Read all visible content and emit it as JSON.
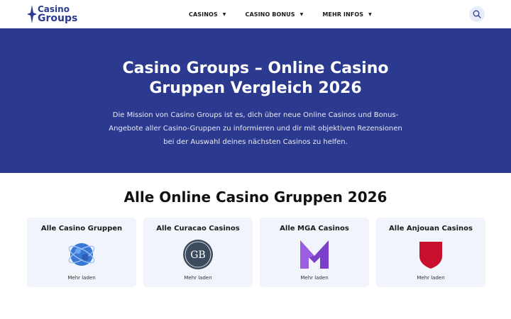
{
  "logo": {
    "line1": "Casino",
    "line2": "Groups"
  },
  "nav": [
    {
      "label": "CASINOS"
    },
    {
      "label": "CASINO BONUS"
    },
    {
      "label": "MEHR INFOS"
    }
  ],
  "hero": {
    "title_line1": "Casino Groups – Online Casino",
    "title_line2": "Gruppen Vergleich 2026",
    "desc_line1": "Die Mission von Casino Groups ist es, dich über neue Online Casinos und Bonus-",
    "desc_line2": "Angebote aller Casino-Gruppen zu informieren und dir mit objektiven Rezensionen",
    "desc_line3": "bei der Auswahl deines nächsten Casinos zu helfen."
  },
  "section": {
    "title": "Alle Online Casino Gruppen 2026"
  },
  "cards": [
    {
      "title": "Alle Casino Gruppen",
      "link": "Mehr laden",
      "icon": "globe-icon"
    },
    {
      "title": "Alle Curacao Casinos",
      "link": "Mehr laden",
      "icon": "gcb-seal-icon"
    },
    {
      "title": "Alle MGA Casinos",
      "link": "Mehr laden",
      "icon": "mga-logo-icon"
    },
    {
      "title": "Alle Anjouan Casinos",
      "link": "Mehr laden",
      "icon": "anjouan-shield-icon"
    }
  ],
  "colors": {
    "brand": "#2b3a8f",
    "card_bg": "#f1f4fb",
    "mga": "#7b3fc9",
    "anjouan": "#c8102e"
  }
}
